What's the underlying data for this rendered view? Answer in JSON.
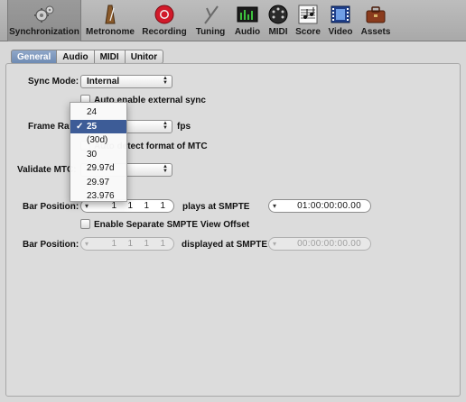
{
  "toolbar": {
    "items": [
      {
        "label": "Synchronization",
        "icon": "gears-icon",
        "selected": true
      },
      {
        "label": "Metronome",
        "icon": "metronome-icon"
      },
      {
        "label": "Recording",
        "icon": "record-icon"
      },
      {
        "label": "Tuning",
        "icon": "tuning-fork-icon"
      },
      {
        "label": "Audio",
        "icon": "audio-meter-icon"
      },
      {
        "label": "MIDI",
        "icon": "midi-port-icon"
      },
      {
        "label": "Score",
        "icon": "score-icon"
      },
      {
        "label": "Video",
        "icon": "film-icon"
      },
      {
        "label": "Assets",
        "icon": "briefcase-icon"
      }
    ]
  },
  "tabs": [
    "General",
    "Audio",
    "MIDI",
    "Unitor"
  ],
  "active_tab": "General",
  "form": {
    "sync_mode_label": "Sync Mode:",
    "sync_mode_value": "Internal",
    "auto_enable_label": "Auto enable external sync",
    "frame_rate_label": "Frame Rate:",
    "fps_label": "fps",
    "detect_label": "Auto detect format of MTC",
    "validate_label": "Validate MTC:",
    "bar_position_label": "Bar Position:",
    "bar_position_values": [
      "1",
      "1",
      "1",
      "1"
    ],
    "plays_at_label": "plays at SMPTE",
    "smpte_value": "01:00:00:00.00",
    "separate_offset_label": "Enable Separate SMPTE View Offset",
    "bar_position2_label": "Bar Position:",
    "bar_position2_values": [
      "1",
      "1",
      "1",
      "1"
    ],
    "displayed_at_label": "displayed at SMPTE",
    "smpte2_value": "00:00:00:00.00"
  },
  "frame_rate_menu": {
    "options": [
      "24",
      "25",
      "(30d)",
      "30",
      "29.97d",
      "29.97",
      "23.976"
    ],
    "selected": "25",
    "check_glyph": "✓"
  }
}
